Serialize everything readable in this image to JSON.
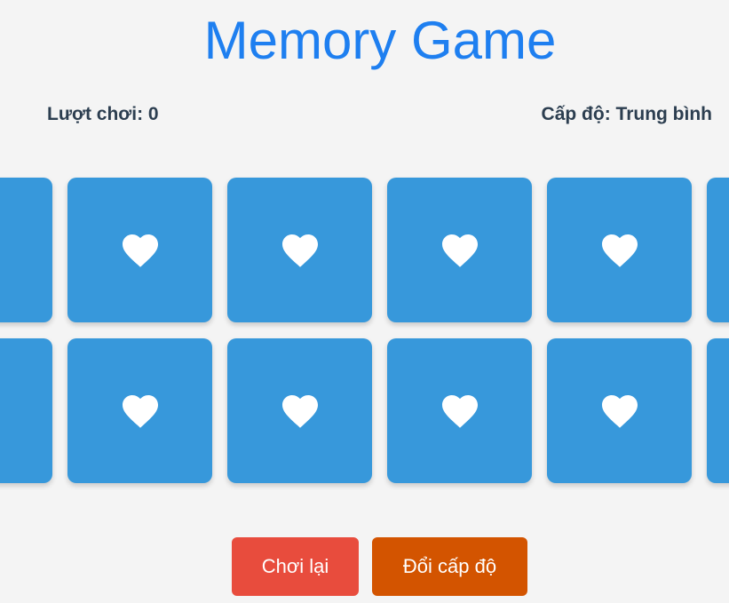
{
  "title": "Memory Game",
  "stats": {
    "moves_label": "Lượt chơi: 0",
    "level_label": "Cấp độ: Trung bình"
  },
  "board": {
    "rows": 2,
    "visible_columns": 6,
    "card_icon": "heart-icon",
    "card_color": "#3798db",
    "icon_color": "#ffffff"
  },
  "buttons": {
    "restart_label": "Chơi lại",
    "change_level_label": "Đổi cấp độ",
    "restart_color": "#e84c3d",
    "change_level_color": "#d35400"
  },
  "colors": {
    "title": "#1e7ff0",
    "text": "#2c3e50",
    "background": "#f4f4f4"
  }
}
